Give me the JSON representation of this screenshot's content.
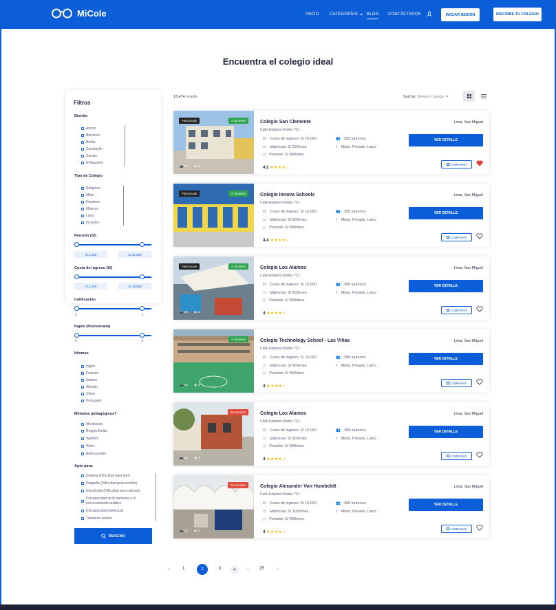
{
  "header": {
    "brand": "MiCole",
    "nav": [
      "INICIO",
      "CATEGORÍAS",
      "BLOG",
      "CONTÁCTANOS"
    ],
    "login": "INICIAR SESIÓN",
    "register": "INSCRIBE TU COLEGIO",
    "accent": "#0b5ed7"
  },
  "page_title": "Encuentra el colegio ideal",
  "filters": {
    "title": "Filtros",
    "distrito": {
      "label": "Distrito",
      "options": [
        "Ancon",
        "Barranco",
        "Breña",
        "Carabayllo",
        "Comas",
        "El Agustino"
      ]
    },
    "tipo": {
      "label": "Tipo de Colegio",
      "options": [
        "Religioso",
        "Mixto",
        "Hombres",
        "Mujeres",
        "Laico",
        "Inclusivo"
      ]
    },
    "pension": {
      "label": "Pensión (S/)",
      "min": "S/.1,200",
      "max": "S/.15,000"
    },
    "cuota": {
      "label": "Cuota de ingreso (S/)",
      "min": "S/.1,200",
      "max": "S/.15,000"
    },
    "calificacion": {
      "label": "Calificación",
      "min": "0",
      "max": "5"
    },
    "ingles": {
      "label": "Inglés (Hrs/semana)",
      "min": "0",
      "max": "8"
    },
    "idiomas": {
      "label": "Idiomas",
      "options": [
        "Inglés",
        "Francés",
        "Italiano",
        "Alemán",
        "Chino",
        "Portugués"
      ]
    },
    "metodos": {
      "label": "Métodos pedagógicos?",
      "options": [
        "Montessori",
        "Reggio Emilia",
        "Waldorf",
        "Pikler",
        "Autocumulier"
      ]
    },
    "apto": {
      "label": "Apto para:",
      "options": [
        "Dislexia (Dificultad para leer)",
        "Disgrafía (Dificultad para escribir)",
        "Discalculia (Dificultad para calcular)",
        "Discapacidad de la memoria y el procesamiento auditivo",
        "Discapacidad intelectual",
        "Trastorno autista"
      ]
    },
    "search": "BUSCAR"
  },
  "results": {
    "count": "13,474",
    "label": "results",
    "sort_label": "Sort by:",
    "sort_value": "Newest Listings"
  },
  "common": {
    "detail": "VER DETALLE",
    "compare": "COMPARAR"
  },
  "schools": [
    {
      "name": "Colegio San Clemente",
      "address": "Calle Estados Unidos 721",
      "cuota": "Cuota de ingreso: S/ 10,000",
      "matricula": "Matrícula: S/ 600/mes",
      "pension": "Pensión: S/ 800/mes",
      "alumnos": "358 alumnos",
      "tipo": "Mixto, Privado, Laico",
      "rating": "4.2",
      "location": "Lima, San Miguel",
      "tag_left": "Patrocinado",
      "tag_right": "5 Vacantes",
      "tag_right_color": "#2ea44f",
      "photos": "22",
      "videos": "3",
      "favorite": true
    },
    {
      "name": "Colegio Innova Schools",
      "address": "Calle Estados Unidos 721",
      "cuota": "Cuota de ingreso: S/ 10,000",
      "matricula": "Matrícula: S/ 800/mes",
      "pension": "Pensión: S/ 800/mes",
      "alumnos": "358 alumnos",
      "tipo": "Mixto, Privado, Laico",
      "rating": "4.4",
      "location": "Lima, San Miguel",
      "tag_left": "Patrocinado",
      "tag_right": "5 Vacantes",
      "tag_right_color": "#2ea44f",
      "photos": "",
      "videos": "",
      "favorite": false
    },
    {
      "name": "Colegio Los Alamos",
      "address": "Calle Estados Unidos 721",
      "cuota": "Cuota de ingreso: S/ 10,000",
      "matricula": "Matrícula: S/ 800/mes",
      "pension": "Pensión: S/ 800/mes",
      "alumnos": "358 alumnos",
      "tipo": "Mixto, Privado, Laico",
      "rating": "4",
      "location": "Lima, San Miguel",
      "tag_left": "Patrocinado",
      "tag_right": "5 Vacantes",
      "tag_right_color": "#2ea44f",
      "photos": "22",
      "videos": "3",
      "favorite": false
    },
    {
      "name": "Colegio Technology School - Las Viñas",
      "address": "Calle Estados Unidos 721",
      "cuota": "Cuota de ingreso: S/ 10,000",
      "matricula": "Matrícula: S/ 800/mes",
      "pension": "Pensión: S/ 800/mes",
      "alumnos": "358 alumnos",
      "tipo": "Mixto, Privado, Laico",
      "rating": "4",
      "location": "Lima, San Miguel",
      "tag_left": "",
      "tag_right": "5 Vacantes",
      "tag_right_color": "#2ea44f",
      "photos": "22",
      "videos": "3",
      "favorite": false
    },
    {
      "name": "Colegio Los Alamos",
      "address": "Calle Estados Unidos 721",
      "cuota": "Cuota de ingreso: S/ 10,000",
      "matricula": "Matrícula: S/ 600/mes",
      "pension": "Pensión: S/ 800/mes",
      "alumnos": "358 alumnos",
      "tipo": "Mixto, Privado, Laico",
      "rating": "4",
      "location": "Lima, San Miguel",
      "tag_left": "",
      "tag_right": "Sin Vacante",
      "tag_right_color": "#e04b3c",
      "photos": "22",
      "videos": "3",
      "favorite": false
    },
    {
      "name": "Colegio Alexander Von Humboldt",
      "address": "Calle Estados Unidos 721",
      "cuota": "Cuota de ingreso: S/ 10,000",
      "matricula": "Matrícula: S/ 1100/mes",
      "pension": "Pensión: S/ 800/mes",
      "alumnos": "358 alumnos",
      "tipo": "Mixto, Privado, Laico",
      "rating": "4",
      "location": "Lima, San Miguel",
      "tag_left": "",
      "tag_right": "Sin Vacante",
      "tag_right_color": "#e04b3c",
      "photos": "22",
      "videos": "3",
      "favorite": false
    }
  ],
  "pagination": {
    "prev": "←",
    "pages": [
      "1",
      "2",
      "3",
      "4",
      "...",
      "25"
    ],
    "current": "2",
    "next": "→"
  }
}
